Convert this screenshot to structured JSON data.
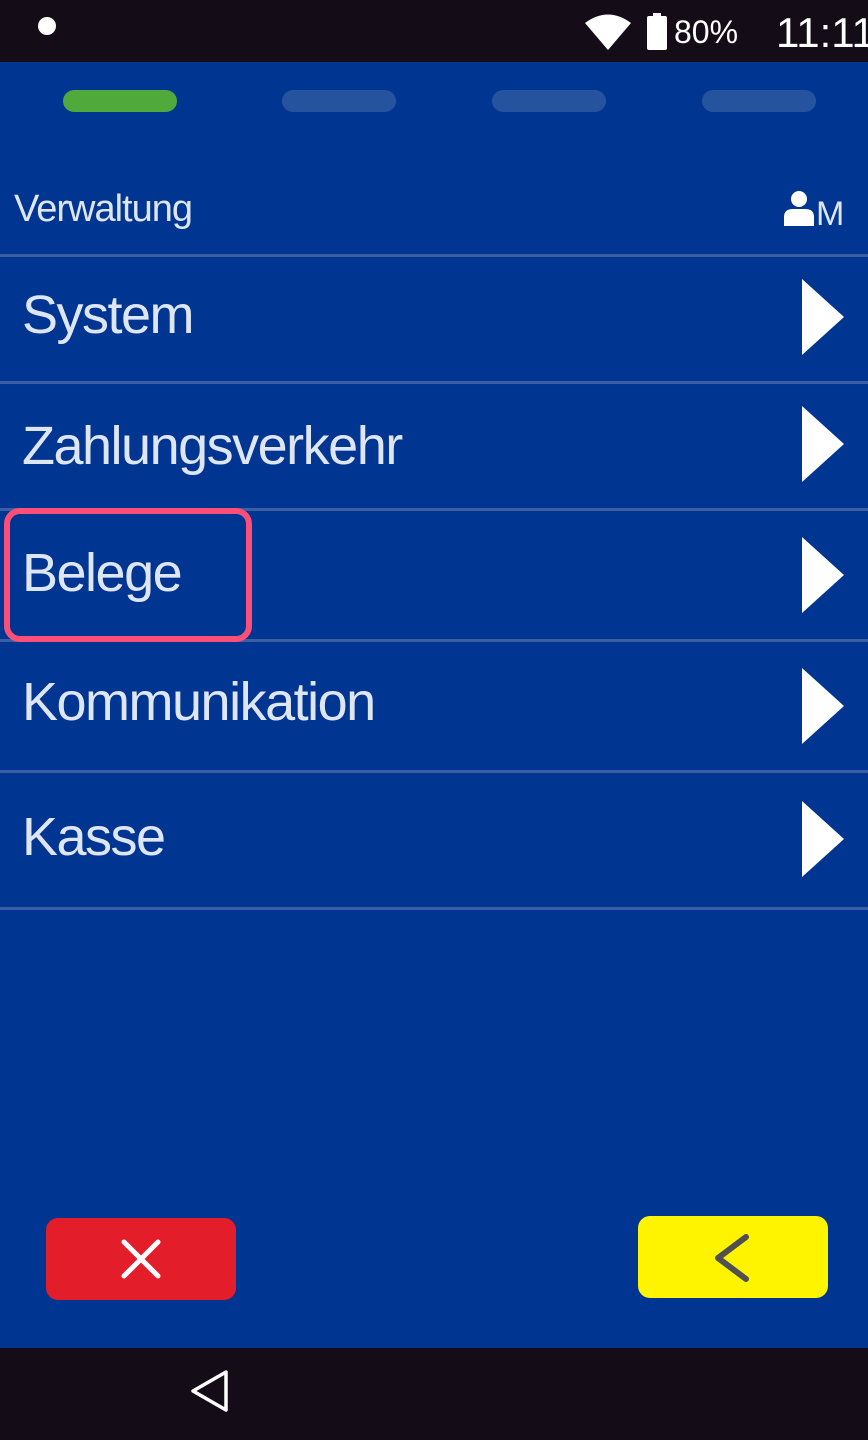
{
  "status_bar": {
    "battery": "80%",
    "time": "11:11"
  },
  "progress": {
    "steps": 4,
    "active_step": 1
  },
  "header": {
    "title": "Verwaltung",
    "user_letter": "M"
  },
  "menu": {
    "items": [
      {
        "label": "System"
      },
      {
        "label": "Zahlungsverkehr"
      },
      {
        "label": "Belege"
      },
      {
        "label": "Kommunikation"
      },
      {
        "label": "Kasse"
      }
    ]
  },
  "buttons": {
    "cancel_icon": "close-icon",
    "back_icon": "chevron-left-icon"
  },
  "colors": {
    "background": "#003591",
    "active_step": "#4faa3b",
    "cancel": "#e41d2b",
    "back": "#fff400",
    "highlight": "#fc4f78"
  }
}
